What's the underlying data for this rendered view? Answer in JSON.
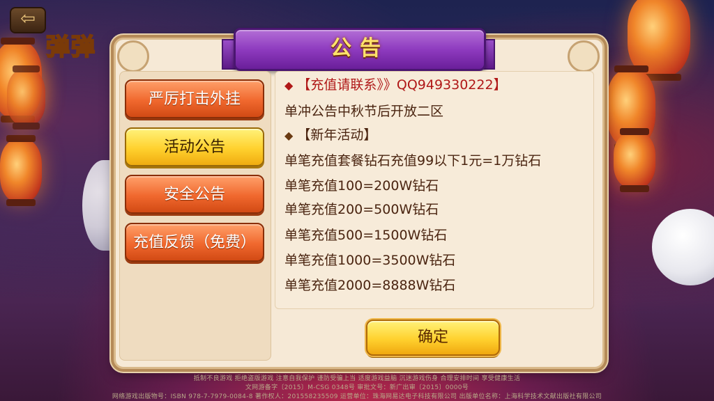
{
  "header": {
    "back_icon": "back-arrow-icon",
    "logo_text": "弹弹"
  },
  "dialog": {
    "title": "公告",
    "tabs": [
      {
        "label": "严厉打击外挂",
        "active": false
      },
      {
        "label": "活动公告",
        "active": true
      },
      {
        "label": "安全公告",
        "active": false
      },
      {
        "label": "充值反馈（免费）",
        "active": false
      }
    ],
    "content_lines": [
      {
        "bullet": "◆",
        "text": "【充值请联系》》QQ949330222】"
      },
      {
        "bullet": "",
        "text": "单冲公告中秋节后开放二区"
      },
      {
        "bullet": "◆",
        "text": "【新年活动】"
      },
      {
        "bullet": "",
        "text": "单笔充值套餐钻石充值99以下1元=1万钻石"
      },
      {
        "bullet": "",
        "text": "单笔充值100=200W钻石"
      },
      {
        "bullet": "",
        "text": "单笔充值200=500W钻石"
      },
      {
        "bullet": "",
        "text": "单笔充值500=1500W钻石"
      },
      {
        "bullet": "",
        "text": "单笔充值1000=3500W钻石"
      },
      {
        "bullet": "",
        "text": "单笔充值2000=8888W钻石"
      }
    ],
    "confirm_label": "确定"
  },
  "footer": {
    "line1": "抵制不良游戏 拒绝盗版游戏 注意自我保护 谨防受骗上当 适度游戏益脑 沉迷游戏伤身 合理安排时间 享受健康生活",
    "line2": "文网游备字〔2015〕M-CSG 0348号 审批文号：新广出审〔2015〕0000号",
    "line3": "网络游戏出版物号：ISBN 978-7-7979-0084-8 著作权人：201558235509 运营单位：珠海网易达电子科技有限公司 出版单位名称：上海科学技术文献出版社有限公司"
  },
  "colors": {
    "ribbon": "#8e3bbf",
    "title_text": "#ffe36b",
    "tab_orange": "#f0682e",
    "tab_yellow": "#ffd12e",
    "content_red": "#b01818",
    "content_text": "#4a2410"
  }
}
